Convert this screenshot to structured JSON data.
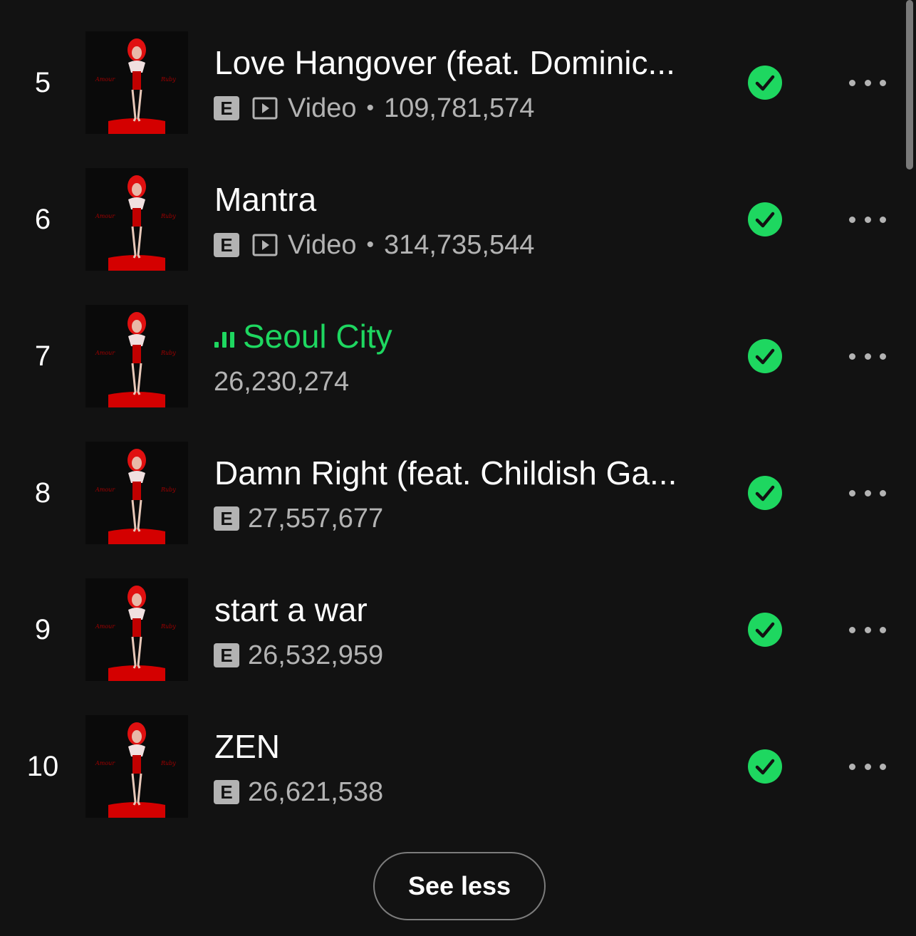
{
  "colors": {
    "background": "#121212",
    "accent_green": "#1ed760",
    "secondary_text": "#b3b3b3",
    "cover_red": "#d40000"
  },
  "tracks": [
    {
      "number": "5",
      "title": "Love Hangover (feat. Dominic...",
      "explicit": "E",
      "has_video": true,
      "video_label": "Video",
      "separator": "•",
      "plays": "109,781,574",
      "playing": false,
      "saved": true
    },
    {
      "number": "6",
      "title": "Mantra",
      "explicit": "E",
      "has_video": true,
      "video_label": "Video",
      "separator": "•",
      "plays": "314,735,544",
      "playing": false,
      "saved": true
    },
    {
      "number": "7",
      "title": "Seoul City",
      "explicit": "",
      "has_video": false,
      "plays": "26,230,274",
      "playing": true,
      "saved": true
    },
    {
      "number": "8",
      "title": "Damn Right (feat. Childish Ga...",
      "explicit": "E",
      "has_video": false,
      "plays": "27,557,677",
      "playing": false,
      "saved": true
    },
    {
      "number": "9",
      "title": "start a war",
      "explicit": "E",
      "has_video": false,
      "plays": "26,532,959",
      "playing": false,
      "saved": true
    },
    {
      "number": "10",
      "title": "ZEN",
      "explicit": "E",
      "has_video": false,
      "plays": "26,621,538",
      "playing": false,
      "saved": true
    }
  ],
  "icons": {
    "saved": "check-circle-icon",
    "more": "more-options-icon",
    "video": "video-icon",
    "playing": "equalizer-icon",
    "explicit": "explicit-badge"
  },
  "see_less_label": "See less"
}
